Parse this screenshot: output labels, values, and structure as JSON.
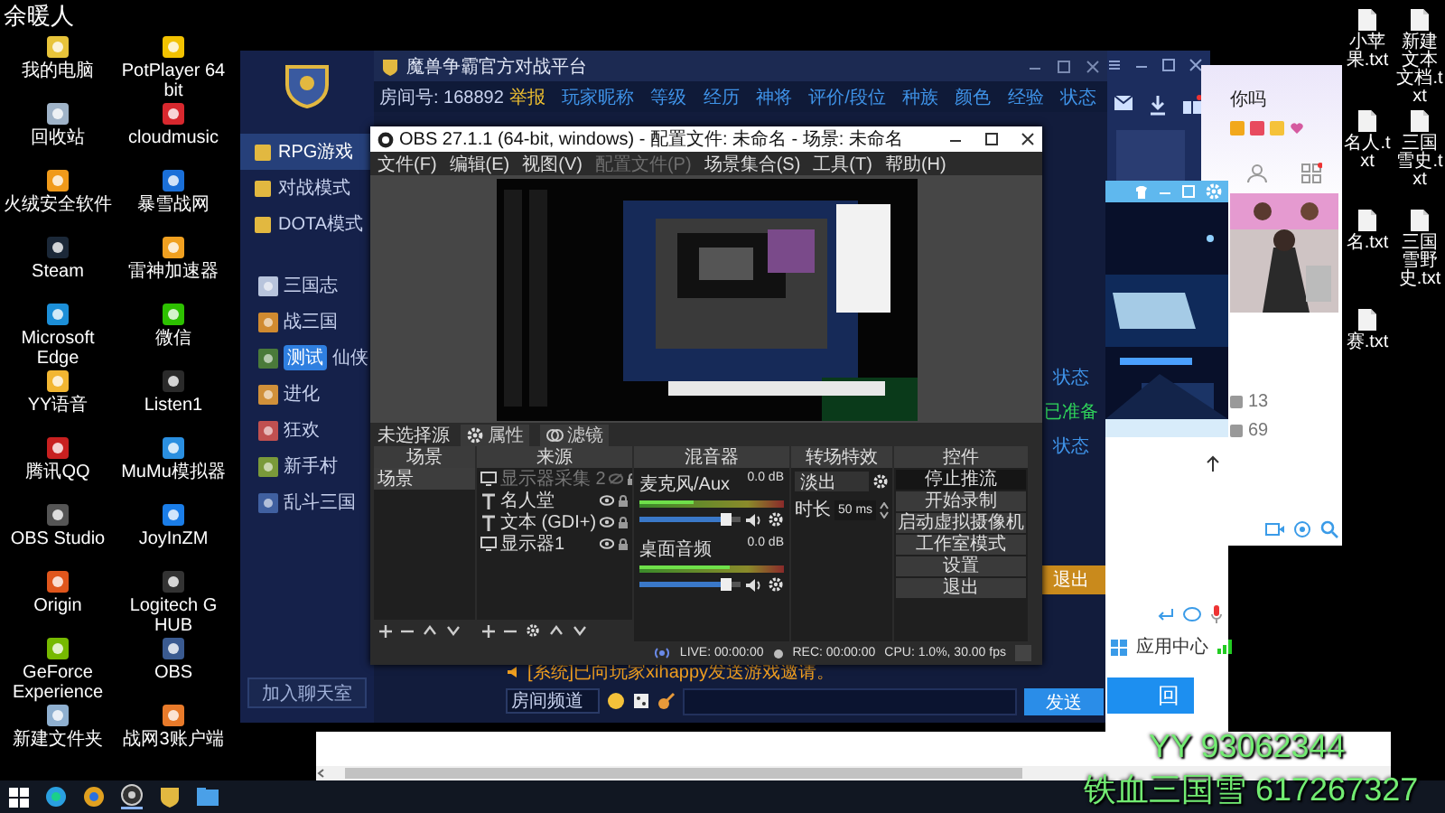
{
  "desktop": {
    "user_label": "余暖人",
    "icons_left": [
      "我的电脑",
      "PotPlayer 64 bit",
      "回收站",
      "cloudmusic",
      "火绒安全软件",
      "暴雪战网",
      "Steam",
      "雷神加速器",
      "Microsoft Edge",
      "微信",
      "YY语音",
      "Listen1",
      "腾讯QQ",
      "MuMu模拟器",
      "OBS Studio",
      "JoyInZM",
      "Origin",
      "Logitech G HUB",
      "GeForce Experience",
      "OBS",
      "新建文件夹",
      "战网3账户端"
    ],
    "icons_right": [
      "小苹果.txt",
      "新建文本文档.txt",
      "名人.txt",
      "三国雪史.txt",
      "名.txt",
      "三国雪野史.txt",
      "赛.txt"
    ]
  },
  "platform": {
    "title": "魔兽争霸官方对战平台",
    "room": "房间号: 168892",
    "report": "举报",
    "nav": [
      {
        "label": "RPG游戏",
        "selected": true
      },
      {
        "label": "对战模式",
        "selected": false
      },
      {
        "label": "DOTA模式",
        "selected": false
      }
    ],
    "games": [
      {
        "label": "三国志"
      },
      {
        "label": "战三国"
      },
      {
        "label": "仙侠",
        "tag": "测试"
      },
      {
        "label": "进化"
      },
      {
        "label": "狂欢"
      },
      {
        "label": "新手村"
      },
      {
        "label": "乱斗三国"
      }
    ],
    "join_chat": "加入聊天室",
    "columns": [
      "玩家昵称",
      "等级",
      "经历",
      "神将",
      "评价/段位",
      "种族",
      "颜色",
      "经验",
      "状态"
    ],
    "statuses": [
      {
        "text": "状态",
        "ready": false
      },
      {
        "text": "已准备",
        "ready": true
      },
      {
        "text": "状态",
        "ready": false
      }
    ],
    "quit": "退出",
    "chat_message": "[系统]已向玩家xihappy发送游戏邀请。",
    "channel": "房间频道",
    "send": "发送"
  },
  "obs": {
    "title": "OBS 27.1.1 (64-bit, windows) - 配置文件: 未命名 - 场景: 未命名",
    "menu": [
      {
        "label": "文件(F)",
        "disabled": false
      },
      {
        "label": "编辑(E)",
        "disabled": false
      },
      {
        "label": "视图(V)",
        "disabled": false
      },
      {
        "label": "配置文件(P)",
        "disabled": true
      },
      {
        "label": "场景集合(S)",
        "disabled": false
      },
      {
        "label": "工具(T)",
        "disabled": false
      },
      {
        "label": "帮助(H)",
        "disabled": false
      }
    ],
    "no_source": "未选择源",
    "source_buttons": [
      "属性",
      "滤镜"
    ],
    "scenes": {
      "title": "场景",
      "items": [
        {
          "label": "场景",
          "selected": true
        }
      ]
    },
    "sources": {
      "title": "来源",
      "items": [
        {
          "label": "显示器采集 2",
          "kind": "display",
          "visible": false
        },
        {
          "label": "名人堂",
          "kind": "text",
          "visible": true
        },
        {
          "label": "文本 (GDI+)",
          "kind": "text",
          "visible": true
        },
        {
          "label": "显示器1",
          "kind": "display",
          "visible": true
        }
      ]
    },
    "mixer": {
      "title": "混音器",
      "channels": [
        {
          "name": "麦克风/Aux",
          "reading": "0.0 dB",
          "level": 0.86
        },
        {
          "name": "桌面音频",
          "reading": "0.0 dB",
          "level": 0.86
        }
      ]
    },
    "transitions": {
      "title": "转场特效",
      "type": "淡出",
      "duration_label": "时长",
      "duration": "50 ms"
    },
    "controls": {
      "title": "控件",
      "buttons": [
        {
          "label": "停止推流",
          "active": true
        },
        {
          "label": "开始录制",
          "active": false
        },
        {
          "label": "启动虚拟摄像机",
          "active": false
        },
        {
          "label": "工作室模式",
          "active": false
        },
        {
          "label": "设置",
          "active": false
        },
        {
          "label": "退出",
          "active": false
        }
      ]
    },
    "status": {
      "live": "LIVE: 00:00:00",
      "rec": "REC: 00:00:00",
      "cpu": "CPU: 1.0%, 30.00 fps"
    }
  },
  "side": {
    "qq_name": "你吗",
    "counts": [
      "13",
      "69"
    ],
    "app_center": "应用中心",
    "back": "回"
  },
  "overlay": {
    "lines": [
      "YY 93062344",
      "铁血三国雪 617267327"
    ]
  }
}
